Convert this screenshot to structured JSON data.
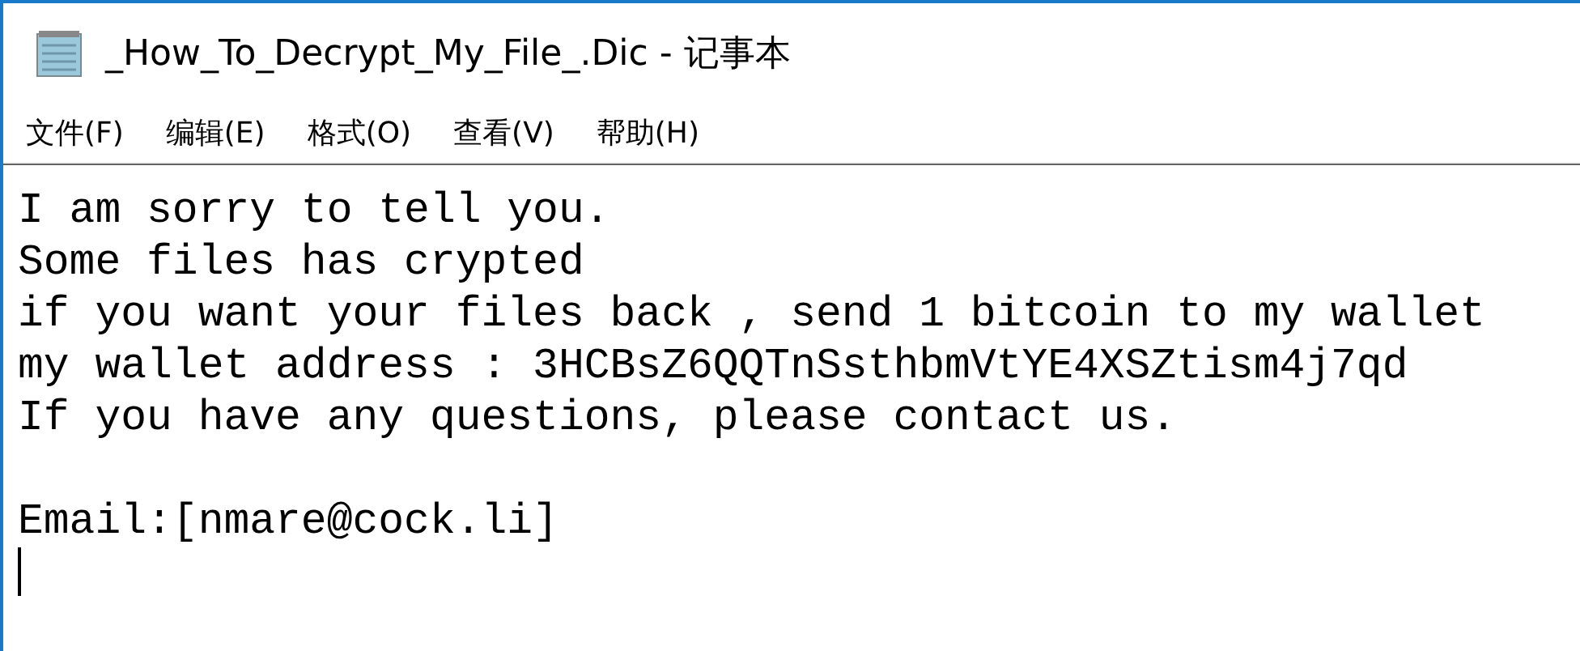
{
  "window": {
    "title": "_How_To_Decrypt_My_File_.Dic - 记事本"
  },
  "menu": [
    {
      "label": "文件(F)"
    },
    {
      "label": "编辑(E)"
    },
    {
      "label": "格式(O)"
    },
    {
      "label": "查看(V)"
    },
    {
      "label": "帮助(H)"
    }
  ],
  "editor": {
    "paragraphs": [
      [
        "I am sorry to tell you.",
        "Some files has crypted",
        "if you want your files back , send 1 bitcoin to my wallet",
        "my wallet address : 3HCBsZ6QQTnSsthbmVtYE4XSZtism4j7qd",
        "If you have any questions, please contact us."
      ],
      [
        "Email:[nmare@cock.li]"
      ]
    ]
  }
}
